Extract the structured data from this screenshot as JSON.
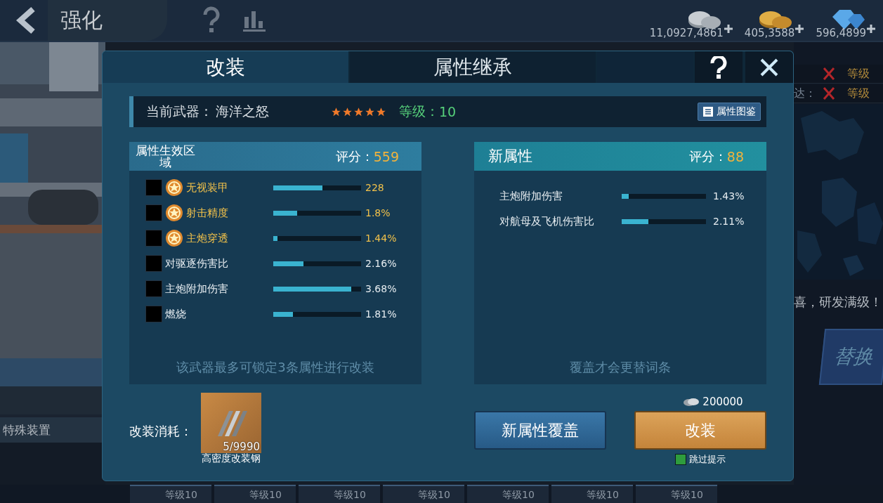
{
  "top_bar": {
    "title": "强化",
    "currencies": [
      {
        "kind": "silver",
        "amount": "11,0927,4861"
      },
      {
        "kind": "gold",
        "amount": "405,3588"
      },
      {
        "kind": "diamond",
        "amount": "596,4899"
      }
    ]
  },
  "background": {
    "side_rows": [
      {
        "grade": "等级"
      },
      {
        "label": "达：",
        "grade": "等级"
      }
    ],
    "message": "喜，研发满级！",
    "replace_button": "替换",
    "special_section": "特殊装置",
    "equipment_cards": [
      {
        "grade": "等级10"
      },
      {
        "grade": "等级10"
      },
      {
        "grade": "等级10"
      },
      {
        "grade": "等级10"
      },
      {
        "grade": "等级10"
      },
      {
        "grade": "等级10"
      },
      {
        "grade": "等级10"
      }
    ]
  },
  "dialog": {
    "tabs": [
      {
        "label": "改装",
        "selected": true
      },
      {
        "label": "属性继承",
        "selected": false
      }
    ],
    "weapon": {
      "label": "当前武器：",
      "name": "海洋之怒",
      "stars": 5,
      "grade_label": "等级：",
      "grade_value": "10"
    },
    "codex_button": "属性图鉴",
    "current_panel": {
      "title": "属性生效区域",
      "score_label": "评分：",
      "score": "559",
      "footer": "该武器最多可锁定3条属性进行改装",
      "attributes": [
        {
          "kind": "special",
          "checked": false,
          "name": "无视装甲",
          "level": 0.56,
          "value": "228"
        },
        {
          "kind": "special",
          "checked": false,
          "name": "射击精度",
          "level": 0.27,
          "value": "1.8%"
        },
        {
          "kind": "special",
          "checked": false,
          "name": "主炮穿透",
          "level": 0.05,
          "value": "1.44%"
        },
        {
          "kind": "normal",
          "checked": false,
          "name": "对驱逐伤害比",
          "level": 0.34,
          "value": "2.16%"
        },
        {
          "kind": "normal",
          "checked": false,
          "name": "主炮附加伤害",
          "level": 0.89,
          "value": "3.68%"
        },
        {
          "kind": "normal",
          "checked": false,
          "name": "燃烧",
          "level": 0.22,
          "value": "1.81%"
        }
      ]
    },
    "new_panel": {
      "title": "新属性",
      "score_label": "评分：",
      "score": "88",
      "footer": "覆盖才会更替词条",
      "attributes": [
        {
          "name": "主炮附加伤害",
          "level": 0.08,
          "value": "1.43%"
        },
        {
          "name": "对航母及飞机伤害比",
          "level": 0.32,
          "value": "2.11%"
        }
      ]
    },
    "cost": {
      "label": "改装消耗：",
      "item_count": "5/9990",
      "item_name": "高密度改装钢"
    },
    "overwrite_button": "新属性覆盖",
    "price": "200000",
    "refit_button": "改装",
    "skip_hint": {
      "label": "跳过提示",
      "checked": true
    }
  }
}
